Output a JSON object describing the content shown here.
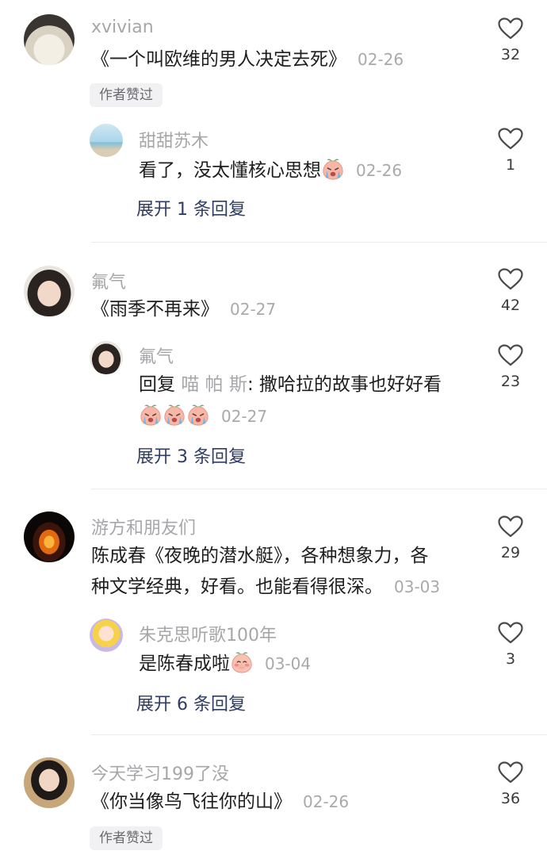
{
  "comments": [
    {
      "username": "xvivian",
      "text": "《一个叫欧维的男人决定去死》",
      "date": "02-26",
      "likes": "32",
      "badge": "作者赞过",
      "reply": {
        "username": "甜甜苏木",
        "text": "看了，没太懂核心思想",
        "date": "02-26",
        "likes": "1",
        "emoji": "crying-peach-icon"
      },
      "expand_label": "展开 1 条回复"
    },
    {
      "username": "氟气",
      "text": "《雨季不再来》",
      "date": "02-27",
      "likes": "42",
      "reply": {
        "username": "氟气",
        "prefix": "回复",
        "reply_to": "喵 帕 斯",
        "text": ": 撒哈拉的故事也好好看",
        "date": "02-27",
        "likes": "23",
        "emoji": "crying-peach-icon"
      },
      "expand_label": "展开 3 条回复"
    },
    {
      "username": "游方和朋友们",
      "text_line1": "陈成春《夜晚的潜水艇》，各种想象力，各",
      "text_line2": "种文学经典，好看。也能看得很深。",
      "date": "03-03",
      "likes": "29",
      "reply": {
        "username": "朱克思听歌100年",
        "text": "是陈春成啦",
        "date": "03-04",
        "likes": "3",
        "emoji": "shy-peach-icon"
      },
      "expand_label": "展开 6 条回复"
    },
    {
      "username": "今天学习199了没",
      "text": "《你当像鸟飞往你的山》",
      "date": "02-26",
      "likes": "36",
      "badge": "作者赞过"
    }
  ]
}
